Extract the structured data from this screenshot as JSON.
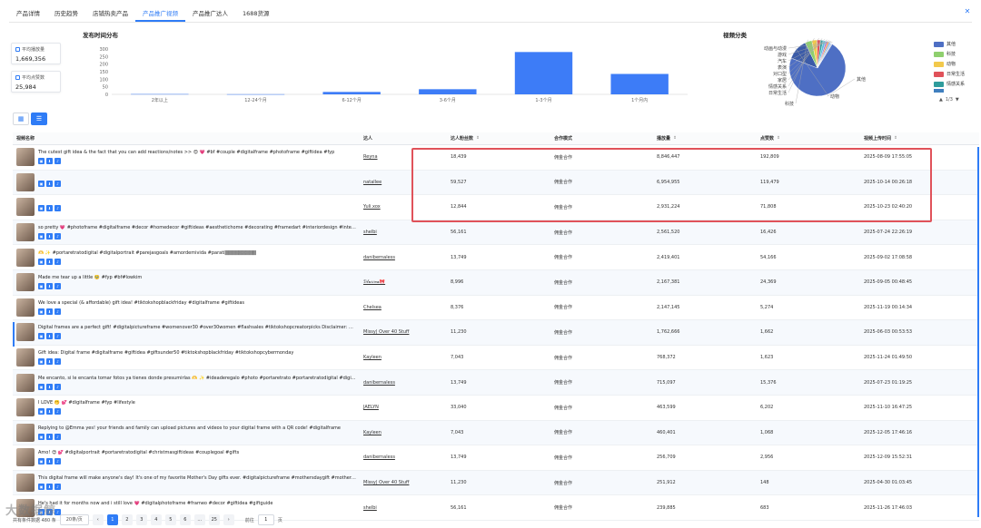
{
  "tabs": [
    {
      "label": "产品详情",
      "active": false
    },
    {
      "label": "历史趋势",
      "active": false
    },
    {
      "label": "店铺热卖产品",
      "active": false
    },
    {
      "label": "产品推广视频",
      "active": true
    },
    {
      "label": "产品推广达人",
      "active": false
    },
    {
      "label": "1688货源",
      "active": false
    }
  ],
  "stats": {
    "avg_views_label": "平均播放量",
    "avg_views_value": "1,669,356",
    "avg_likes_label": "平均点赞数",
    "avg_likes_value": "25,984"
  },
  "publish_chart_title": "发布时间分布",
  "category_chart_title": "视频分类",
  "chart_data": [
    {
      "type": "bar",
      "title": "发布时间分布",
      "categories": [
        "2年以上",
        "12-24个月",
        "6-12个月",
        "3-6个月",
        "1-3个月",
        "1个月内"
      ],
      "values": [
        2,
        1,
        16,
        34,
        280,
        135
      ],
      "ylim": [
        0,
        300
      ],
      "yticks": [
        0,
        50,
        100,
        150,
        200,
        250,
        300
      ],
      "color": "#3d7cf7",
      "grid": false
    },
    {
      "type": "pie",
      "title": "视频分类",
      "labels": [
        "其他",
        "动物",
        "科技",
        "日常生活",
        "情感关系",
        "家居",
        "对口型",
        "表演",
        "汽车",
        "游戏",
        "动画与动漫"
      ],
      "values": [
        72,
        12,
        4,
        3,
        2,
        1.5,
        1.5,
        1,
        1,
        1,
        1
      ],
      "colors": [
        "#4e6fc4",
        "#3b5ba8",
        "#8fcf6e",
        "#f2c94c",
        "#e0525a",
        "#2f9c9c",
        "#5bc0de",
        "#9b6fd1",
        "#f08c4a",
        "#7fb3e8",
        "#c7d2e6"
      ],
      "legend_position": "right"
    }
  ],
  "legend": {
    "items": [
      {
        "label": "其他",
        "color": "#4e6fc4"
      },
      {
        "label": "科技",
        "color": "#8fcf6e"
      },
      {
        "label": "动物",
        "color": "#f2c94c"
      },
      {
        "label": "日常生活",
        "color": "#e0525a"
      },
      {
        "label": "情感关系",
        "color": "#2f9c9c"
      },
      {
        "label": "",
        "color": "#3f7fbf"
      }
    ],
    "page": "1/3"
  },
  "table": {
    "headers": {
      "video": "视频名称",
      "creator": "达人",
      "followers": "达人粉丝数",
      "mode": "合作模式",
      "views": "播放量",
      "likes": "点赞数",
      "upload_time": "视频上传时间"
    },
    "rows": [
      {
        "title": "The cutest gift idea & the fact that you can add reactions/notes >> 😍 💗 #bf #couple #digitalframe #photoframe #giftidea #fyp",
        "creator": "Reyna",
        "followers": "18,439",
        "mode": "佣金合作",
        "views": "8,846,447",
        "likes": "192,809",
        "time": "2025-08-09 17:55:05"
      },
      {
        "title": "",
        "creator": "natallee",
        "followers": "59,527",
        "mode": "佣金合作",
        "views": "6,954,955",
        "likes": "119,479",
        "time": "2025-10-14 00:26:18"
      },
      {
        "title": "",
        "creator": "Yuli.xox",
        "followers": "12,844",
        "mode": "佣金合作",
        "views": "2,931,224",
        "likes": "71,808",
        "time": "2025-10-23 02:40:20"
      },
      {
        "title": "so pretty 💗 #photoframe #digitalframe #decor #homedecor #giftideas #aesthetichome #decorating #framedart #interiordesign #interior...",
        "creator": "shelbi",
        "followers": "56,161",
        "mode": "佣金合作",
        "views": "2,561,520",
        "likes": "16,426",
        "time": "2025-07-24 22:26:19"
      },
      {
        "title": "🫶 ✨ #portaretratodigital #digitalportrait #parejasgoals #amordemivida #parati▒▒▒▒▒▒▒▒▒",
        "creator": "danibernaless",
        "followers": "13,749",
        "mode": "佣金合作",
        "views": "2,419,401",
        "likes": "54,166",
        "time": "2025-09-02 17:08:58"
      },
      {
        "title": "Made me tear up a little 🥹 #fyp #bf#lowkim",
        "creator": "ℬ𝓁𝒶𝓇𝒾𝓃𝒶🎀",
        "followers": "8,996",
        "mode": "佣金合作",
        "views": "2,167,381",
        "likes": "24,369",
        "time": "2025-09-05 00:48:45"
      },
      {
        "title": "We love a special (& affordable) gift idea! #tiktokshopblackfriday #digitalframe #giftideas",
        "creator": "Chelsea",
        "followers": "8,376",
        "mode": "佣金合作",
        "views": "2,147,145",
        "likes": "5,274",
        "time": "2025-11-19 00:14:34"
      },
      {
        "title": "Digital frames are a perfect gift! #digitalpictureframe #womenover30 #over30women #flashsales #tiktokshopcreatorpicks Disclaimer: Di...",
        "creator": "Missy| Over 40 Stuff",
        "followers": "11,230",
        "mode": "佣金合作",
        "views": "1,762,666",
        "likes": "1,662",
        "time": "2025-06-03 00:53:53"
      },
      {
        "title": "Gift idea: Digital frame #digitalframe #giftidea #giftsunder50 #tiktokshopblackfriday #tiktokshopcybermonday",
        "creator": "Kayleen",
        "followers": "7,043",
        "mode": "佣金合作",
        "views": "768,372",
        "likes": "1,623",
        "time": "2025-11-24 01:49:50"
      },
      {
        "title": "Me encanto, si le encanta tomar fotos ya tienes donde presumirlas 🫶 ✨ #ideaderegalo #photo #portaretrato #portaretratodigital #digi...",
        "creator": "danibernaless",
        "followers": "13,749",
        "mode": "佣金合作",
        "views": "715,097",
        "likes": "15,376",
        "time": "2025-07-23 01:19:25"
      },
      {
        "title": "I LOVE 🤭 💕 #digitalframe #fyp #lifestyle",
        "creator": "JAELYN",
        "followers": "33,040",
        "mode": "佣金合作",
        "views": "463,599",
        "likes": "6,202",
        "time": "2025-11-10 16:47:25"
      },
      {
        "title": "Replying to @Emma yes! your friends and family can upload pictures and videos to your digital frame with a QR code! #digitalframe",
        "creator": "Kayleen",
        "followers": "7,043",
        "mode": "佣金合作",
        "views": "460,401",
        "likes": "1,068",
        "time": "2025-12-05 17:46:16"
      },
      {
        "title": "Amo! 😍 💕 #digitalportrait #portaretratodigital #christmasgiftideas #couplegoal #gifts",
        "creator": "danibernaless",
        "followers": "13,749",
        "mode": "佣金合作",
        "views": "256,709",
        "likes": "2,956",
        "time": "2025-12-09 15:52:31"
      },
      {
        "title": "This digital frame will make anyone's day! It's one of my favorite Mother's Day gifts ever. #digitalpictureframe #mothersdaygift #mothers...",
        "creator": "Missy| Over 40 Stuff",
        "followers": "11,230",
        "mode": "佣金合作",
        "views": "251,912",
        "likes": "148",
        "time": "2025-04-30 01:03:45"
      },
      {
        "title": "He's had it for months now and i still love 💗 #digitalphotoframe #frameo #decor #giftidea #giftguide",
        "creator": "shelbi",
        "followers": "56,161",
        "mode": "佣金合作",
        "views": "239,885",
        "likes": "683",
        "time": "2025-11-26 17:46:03"
      }
    ]
  },
  "footer": {
    "total": "共有条件数据 480 条",
    "page_size": "20条/页",
    "pages": [
      "1",
      "2",
      "3",
      "4",
      "5",
      "6",
      "...",
      "25"
    ],
    "prev": "‹",
    "next": "›",
    "goto_label": "前往",
    "goto_value": "1",
    "page_unit": "页"
  },
  "watermark": "大数据鲸"
}
